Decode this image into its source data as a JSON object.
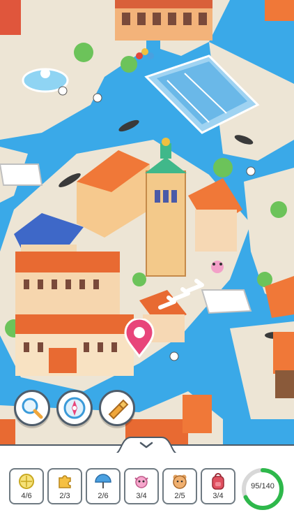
{
  "tools": [
    {
      "name": "magnifier",
      "icon": "magnifier-icon"
    },
    {
      "name": "compass",
      "icon": "compass-icon"
    },
    {
      "name": "spyglass",
      "icon": "spyglass-icon"
    }
  ],
  "items": [
    {
      "icon": "lemon-icon",
      "count": "4/6"
    },
    {
      "icon": "puzzle-icon",
      "count": "2/3"
    },
    {
      "icon": "umbrella-icon",
      "count": "2/6"
    },
    {
      "icon": "axolotl-icon",
      "count": "3/4"
    },
    {
      "icon": "teddy-bear-icon",
      "count": "2/5"
    },
    {
      "icon": "backpack-icon",
      "count": "3/4"
    }
  ],
  "progress": {
    "label": "95/140",
    "found": 95,
    "total": 140,
    "color": "#2eb84b"
  },
  "colors": {
    "water": "#35a8e6",
    "roof": "#f07838",
    "ground": "#ece4d4",
    "accent": "#e8457a"
  }
}
